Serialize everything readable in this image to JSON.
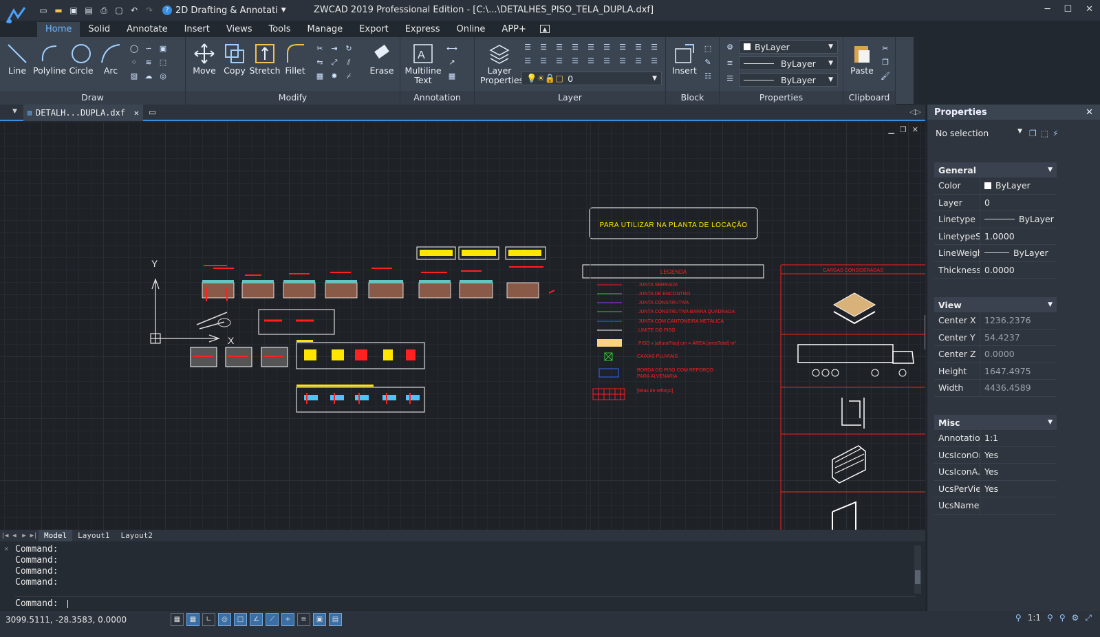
{
  "title_bar": {
    "workspace": "2D Drafting & Annotati",
    "window_title": "ZWCAD 2019 Professional Edition - [C:\\...\\DETALHES_PISO_TELA_DUPLA.dxf]"
  },
  "ribbon_tabs": [
    "Home",
    "Solid",
    "Annotate",
    "Insert",
    "Views",
    "Tools",
    "Manage",
    "Export",
    "Express",
    "Online",
    "APP+"
  ],
  "ribbon": {
    "draw": {
      "title": "Draw",
      "line": "Line",
      "polyline": "Polyline",
      "circle": "Circle",
      "arc": "Arc"
    },
    "modify": {
      "title": "Modify",
      "move": "Move",
      "copy": "Copy",
      "stretch": "Stretch",
      "fillet": "Fillet",
      "erase": "Erase"
    },
    "annotation": {
      "title": "Annotation",
      "mtext_1": "Multiline",
      "mtext_2": "Text"
    },
    "layer": {
      "title": "Layer",
      "props_1": "Layer",
      "props_2": "Properties",
      "current": "0"
    },
    "block": {
      "title": "Block",
      "insert": "Insert"
    },
    "properties": {
      "title": "Properties",
      "color": "ByLayer",
      "linetype": "ByLayer",
      "lineweight": "ByLayer"
    },
    "clipboard": {
      "title": "Clipboard",
      "paste": "Paste"
    }
  },
  "doc_tab": {
    "name": "DETALH...DUPLA.dxf"
  },
  "drawing": {
    "banner": "PARA UTILIZAR NA PLANTA DE LOCAÇÃO",
    "legend_title": "LEGENDA",
    "legend_items": [
      "JUNTA SERRADA",
      "JUNTA DE ENCONTRO",
      "JUNTA CONSTRUTIVA",
      "JUNTA CONSTRUTIVA BARRA QUADRADA",
      "JUNTA COM CANTONEIRA METÁLICA",
      "LIMITE DO PISO",
      "PISO x [alturaPiso] cm = ÁREA [areaTotal] m²",
      "CAIXAS PLUVIAIS",
      "BORDA DO PISO COM REFORÇO",
      "PARA ALVENARIA",
      "[telas de reforço]"
    ],
    "cargas_title": "CARGAS CONSIDERADAS",
    "ucs_y": "Y",
    "ucs_x": "X"
  },
  "layout_tabs": [
    "Model",
    "Layout1",
    "Layout2"
  ],
  "command": {
    "history": [
      "Command:",
      "Command:",
      "Command:",
      "Command:"
    ],
    "prompt": "Command:"
  },
  "status": {
    "coords": "3099.5111, -28.3583, 0.0000",
    "scale": "1:1"
  },
  "properties_panel": {
    "title": "Properties",
    "selection": "No selection",
    "general": {
      "title": "General",
      "rows": [
        {
          "k": "Color",
          "v": "ByLayer"
        },
        {
          "k": "Layer",
          "v": "0"
        },
        {
          "k": "Linetype",
          "v": "ByLayer"
        },
        {
          "k": "LinetypeS...",
          "v": "1.0000"
        },
        {
          "k": "LineWeight",
          "v": "ByLayer"
        },
        {
          "k": "Thickness",
          "v": "0.0000"
        }
      ]
    },
    "view": {
      "title": "View",
      "rows": [
        {
          "k": "Center X",
          "v": "1236.2376"
        },
        {
          "k": "Center Y",
          "v": "54.4237"
        },
        {
          "k": "Center Z",
          "v": "0.0000"
        },
        {
          "k": "Height",
          "v": "1647.4975"
        },
        {
          "k": "Width",
          "v": "4436.4589"
        }
      ]
    },
    "misc": {
      "title": "Misc",
      "rows": [
        {
          "k": "Annotatio...",
          "v": "1:1"
        },
        {
          "k": "UcsIconOn",
          "v": "Yes"
        },
        {
          "k": "UcsIconA...",
          "v": "Yes"
        },
        {
          "k": "UcsPerVie...",
          "v": "Yes"
        },
        {
          "k": "UcsName",
          "v": ""
        }
      ]
    }
  }
}
